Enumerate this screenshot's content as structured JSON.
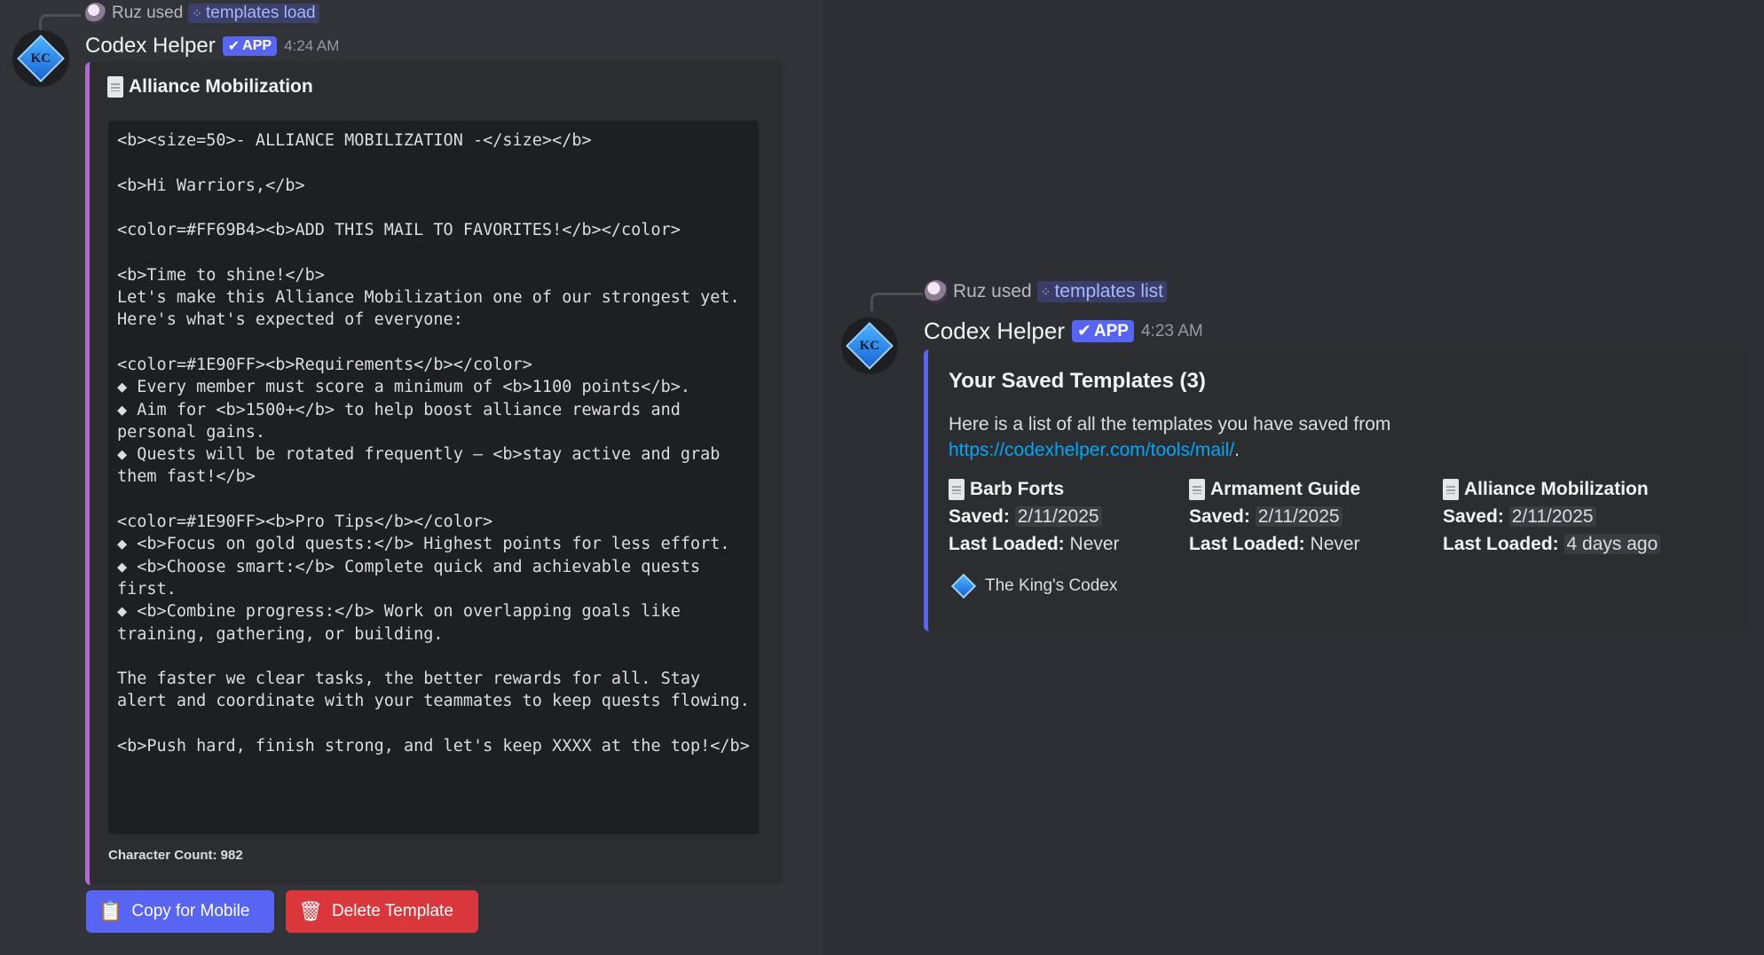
{
  "left_message": {
    "reply": {
      "user": "Ruz used",
      "command": "templates load"
    },
    "bot": {
      "name": "Codex Helper",
      "badge": "APP",
      "time": "4:24 AM",
      "avatar_text": "KC"
    },
    "embed": {
      "title": "Alliance Mobilization",
      "code": "<b><size=50>- ALLIANCE MOBILIZATION -</size></b>\n\n<b>Hi Warriors,</b>\n\n<color=#FF69B4><b>ADD THIS MAIL TO FAVORITES!</b></color>\n\n<b>Time to shine!</b>\nLet's make this Alliance Mobilization one of our strongest yet. Here's what's expected of everyone:\n\n<color=#1E90FF><b>Requirements</b></color>\n◆ Every member must score a minimum of <b>1100 points</b>.\n◆ Aim for <b>1500+</b> to help boost alliance rewards and personal gains.\n◆ Quests will be rotated frequently — <b>stay active and grab them fast!</b>\n\n<color=#1E90FF><b>Pro Tips</b></color>\n◆ <b>Focus on gold quests:</b> Highest points for less effort.\n◆ <b>Choose smart:</b> Complete quick and achievable quests first.\n◆ <b>Combine progress:</b> Work on overlapping goals like training, gathering, or building.\n\nThe faster we clear tasks, the better rewards for all. Stay alert and coordinate with your teammates to keep quests flowing.\n\n<b>Push hard, finish strong, and let's keep XXXX at the top!</b>",
      "footer": "Character Count: 982"
    },
    "buttons": {
      "copy": {
        "label": "Copy for Mobile",
        "icon": "📋"
      },
      "delete": {
        "label": "Delete Template",
        "icon": "🗑"
      }
    }
  },
  "right_message": {
    "reply": {
      "user": "Ruz used",
      "command": "templates list"
    },
    "bot": {
      "name": "Codex Helper",
      "badge": "APP",
      "time": "4:23 AM",
      "avatar_text": "KC"
    },
    "embed": {
      "title": "Your Saved Templates (3)",
      "description": "Here is a list of all the templates you have saved from",
      "link": "https://codexhelper.com/tools/mail/",
      "link_suffix": ".",
      "saved_label": "Saved:",
      "loaded_label": "Last Loaded:",
      "templates": [
        {
          "name": "Barb Forts",
          "saved": "2/11/2025",
          "loaded": "Never"
        },
        {
          "name": "Armament Guide",
          "saved": "2/11/2025",
          "loaded": "Never"
        },
        {
          "name": "Alliance Mobilization",
          "saved": "2/11/2025",
          "loaded": "4 days ago"
        }
      ],
      "footer": "The King's Codex"
    }
  },
  "colors": {
    "accent_left": "#b068d8",
    "accent_right": "#5865f2",
    "button_blue": "#5865f2",
    "button_red": "#da373c",
    "link": "#00a8fc"
  }
}
